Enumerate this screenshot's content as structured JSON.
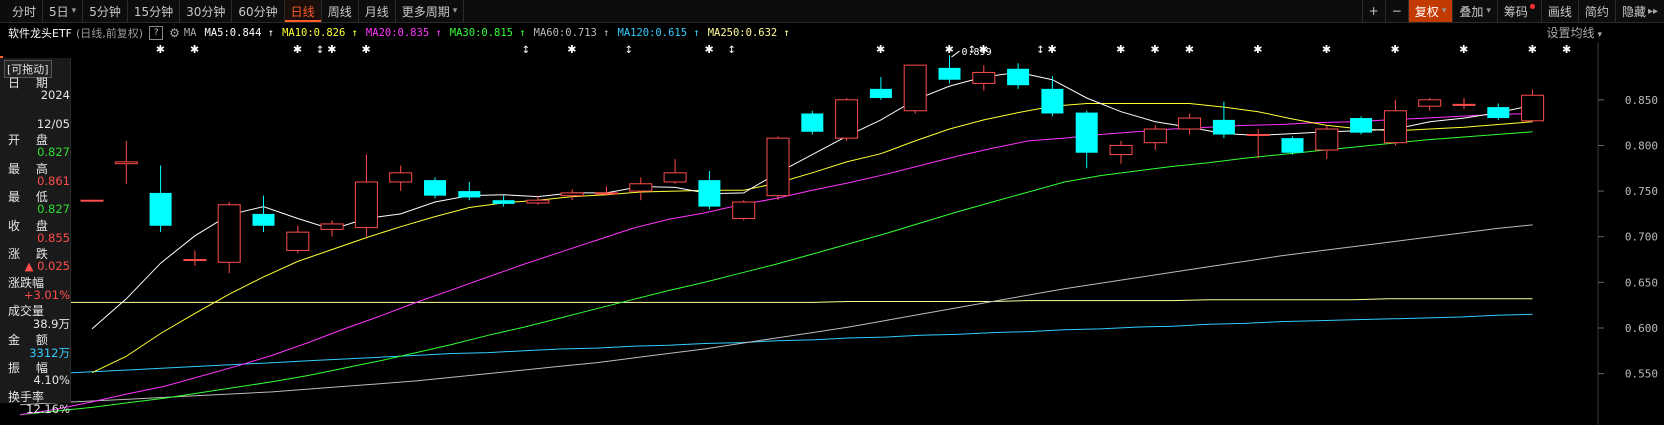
{
  "toolbar": {
    "periods": [
      {
        "label": "分时",
        "caret": false,
        "active": false
      },
      {
        "label": "5日",
        "caret": true,
        "active": false
      },
      {
        "label": "5分钟",
        "caret": false,
        "active": false
      },
      {
        "label": "15分钟",
        "caret": false,
        "active": false
      },
      {
        "label": "30分钟",
        "caret": false,
        "active": false
      },
      {
        "label": "60分钟",
        "caret": false,
        "active": false
      },
      {
        "label": "日线",
        "caret": false,
        "active": true
      },
      {
        "label": "周线",
        "caret": false,
        "active": false
      },
      {
        "label": "月线",
        "caret": false,
        "active": false
      },
      {
        "label": "更多周期",
        "caret": true,
        "active": false
      }
    ],
    "right": {
      "plus": "+",
      "minus": "−",
      "fq": "复权",
      "overlay": "叠加",
      "chips": "筹码",
      "draw": "画线",
      "simple": "简约",
      "hide": "隐藏",
      "hide_arrow": "▸▸"
    }
  },
  "header": {
    "name": "软件龙头ETF",
    "sub": "(日线,前复权)",
    "q": "?",
    "gear": "⚙",
    "ma_label": "MA",
    "set_ma": "设置均线",
    "set_ma_caret": "▾",
    "mas": [
      {
        "label": "MA5:0.844",
        "arrow": "↑",
        "color": "#ffffff"
      },
      {
        "label": "MA10:0.826",
        "arrow": "↑",
        "color": "#ffff33"
      },
      {
        "label": "MA20:0.835",
        "arrow": "↑",
        "color": "#ff33ff"
      },
      {
        "label": "MA30:0.815",
        "arrow": "↑",
        "color": "#33ff33"
      },
      {
        "label": "MA60:0.713",
        "arrow": "↑",
        "color": "#bbbbbb"
      },
      {
        "label": "MA120:0.615",
        "arrow": "↑",
        "color": "#33ccff"
      },
      {
        "label": "MA250:0.632",
        "arrow": "↑",
        "color": "#ffff99"
      }
    ]
  },
  "info": {
    "drag_label": "[可拖动]",
    "rows": [
      {
        "label": "日 期",
        "value": "2024",
        "color": "#e6e6e6"
      },
      {
        "label": "",
        "value": "12/05",
        "color": "#e6e6e6"
      },
      {
        "label": "开 盘",
        "value": "0.827",
        "color": "#33dd33"
      },
      {
        "label": "最 高",
        "value": "0.861",
        "color": "#ff4d4d"
      },
      {
        "label": "最 低",
        "value": "0.827",
        "color": "#33dd33"
      },
      {
        "label": "收 盘",
        "value": "0.855",
        "color": "#ff4d4d"
      },
      {
        "label": "涨 跌",
        "value": "▲ 0.025",
        "color": "#ff4d4d"
      },
      {
        "label": "涨跌幅",
        "value": "+3.01%",
        "color": "#ff4d4d"
      },
      {
        "label": "成交量",
        "value": "38.9万",
        "color": "#e6e6e6"
      },
      {
        "label": "金 额",
        "value": "3312万",
        "color": "#33ccff"
      },
      {
        "label": "振 幅",
        "value": "4.10%",
        "color": "#e6e6e6"
      },
      {
        "label": "换手率",
        "value": "12.16%",
        "color": "#e6e6e6"
      }
    ]
  },
  "chart_data": {
    "type": "candlestick",
    "y_ticks": [
      0.85,
      0.8,
      0.75,
      0.7,
      0.65,
      0.6,
      0.55
    ],
    "y_tick_labels": [
      "0.850",
      "0.800",
      "0.750",
      "0.700",
      "0.650",
      "0.600",
      "0.550"
    ],
    "ylim": [
      0.497,
      0.898
    ],
    "annotation": "0.899",
    "colors": {
      "up": "#ff4d4d",
      "down": "#00ffff",
      "ma5": "#ffffff",
      "ma10": "#ffff33",
      "ma20": "#ff33ff",
      "ma30": "#33ff33",
      "ma60": "#bbbbbb",
      "ma120": "#33ccff",
      "ma250": "#ffff99",
      "grid": "#333333"
    },
    "candles": [
      {
        "o": 0.74,
        "h": 0.74,
        "l": 0.74,
        "c": 0.74
      },
      {
        "o": 0.78,
        "h": 0.805,
        "l": 0.758,
        "c": 0.782
      },
      {
        "o": 0.748,
        "h": 0.778,
        "l": 0.705,
        "c": 0.712
      },
      {
        "o": 0.675,
        "h": 0.685,
        "l": 0.668,
        "c": 0.675
      },
      {
        "o": 0.672,
        "h": 0.738,
        "l": 0.66,
        "c": 0.735
      },
      {
        "o": 0.725,
        "h": 0.745,
        "l": 0.705,
        "c": 0.712
      },
      {
        "o": 0.685,
        "h": 0.712,
        "l": 0.682,
        "c": 0.705
      },
      {
        "o": 0.708,
        "h": 0.718,
        "l": 0.7,
        "c": 0.714
      },
      {
        "o": 0.71,
        "h": 0.79,
        "l": 0.7,
        "c": 0.76
      },
      {
        "o": 0.76,
        "h": 0.778,
        "l": 0.75,
        "c": 0.77
      },
      {
        "o": 0.762,
        "h": 0.765,
        "l": 0.742,
        "c": 0.745
      },
      {
        "o": 0.75,
        "h": 0.76,
        "l": 0.74,
        "c": 0.743
      },
      {
        "o": 0.74,
        "h": 0.745,
        "l": 0.733,
        "c": 0.736
      },
      {
        "o": 0.737,
        "h": 0.745,
        "l": 0.735,
        "c": 0.74
      },
      {
        "o": 0.745,
        "h": 0.752,
        "l": 0.74,
        "c": 0.748
      },
      {
        "o": 0.748,
        "h": 0.755,
        "l": 0.745,
        "c": 0.748
      },
      {
        "o": 0.75,
        "h": 0.765,
        "l": 0.74,
        "c": 0.758
      },
      {
        "o": 0.76,
        "h": 0.785,
        "l": 0.758,
        "c": 0.77
      },
      {
        "o": 0.762,
        "h": 0.772,
        "l": 0.73,
        "c": 0.733
      },
      {
        "o": 0.72,
        "h": 0.74,
        "l": 0.718,
        "c": 0.738
      },
      {
        "o": 0.745,
        "h": 0.81,
        "l": 0.74,
        "c": 0.808
      },
      {
        "o": 0.835,
        "h": 0.838,
        "l": 0.812,
        "c": 0.815
      },
      {
        "o": 0.808,
        "h": 0.852,
        "l": 0.805,
        "c": 0.85
      },
      {
        "o": 0.862,
        "h": 0.875,
        "l": 0.85,
        "c": 0.852
      },
      {
        "o": 0.838,
        "h": 0.888,
        "l": 0.835,
        "c": 0.888
      },
      {
        "o": 0.885,
        "h": 0.899,
        "l": 0.868,
        "c": 0.872
      },
      {
        "o": 0.868,
        "h": 0.888,
        "l": 0.86,
        "c": 0.88
      },
      {
        "o": 0.884,
        "h": 0.89,
        "l": 0.862,
        "c": 0.866
      },
      {
        "o": 0.862,
        "h": 0.876,
        "l": 0.832,
        "c": 0.835
      },
      {
        "o": 0.836,
        "h": 0.838,
        "l": 0.775,
        "c": 0.792
      },
      {
        "o": 0.79,
        "h": 0.805,
        "l": 0.78,
        "c": 0.8
      },
      {
        "o": 0.803,
        "h": 0.822,
        "l": 0.795,
        "c": 0.818
      },
      {
        "o": 0.818,
        "h": 0.835,
        "l": 0.812,
        "c": 0.83
      },
      {
        "o": 0.828,
        "h": 0.848,
        "l": 0.808,
        "c": 0.812
      },
      {
        "o": 0.812,
        "h": 0.818,
        "l": 0.786,
        "c": 0.812
      },
      {
        "o": 0.808,
        "h": 0.81,
        "l": 0.79,
        "c": 0.792
      },
      {
        "o": 0.795,
        "h": 0.822,
        "l": 0.785,
        "c": 0.818
      },
      {
        "o": 0.83,
        "h": 0.832,
        "l": 0.812,
        "c": 0.814
      },
      {
        "o": 0.803,
        "h": 0.85,
        "l": 0.8,
        "c": 0.838
      },
      {
        "o": 0.843,
        "h": 0.852,
        "l": 0.838,
        "c": 0.85
      },
      {
        "o": 0.845,
        "h": 0.852,
        "l": 0.84,
        "c": 0.845
      },
      {
        "o": 0.842,
        "h": 0.846,
        "l": 0.828,
        "c": 0.83
      },
      {
        "o": 0.827,
        "h": 0.861,
        "l": 0.827,
        "c": 0.855
      }
    ],
    "ma_lines": {
      "ma5": [
        0.599,
        0.632,
        0.671,
        0.701,
        0.724,
        0.733,
        0.72,
        0.708,
        0.72,
        0.725,
        0.738,
        0.745,
        0.746,
        0.744,
        0.748,
        0.748,
        0.755,
        0.754,
        0.747,
        0.748,
        0.77,
        0.79,
        0.81,
        0.828,
        0.85,
        0.865,
        0.875,
        0.88,
        0.872,
        0.852,
        0.837,
        0.826,
        0.82,
        0.813,
        0.811,
        0.813,
        0.815,
        0.816,
        0.818,
        0.826,
        0.83,
        0.836,
        0.844
      ],
      "ma10": [
        0.551,
        0.569,
        0.594,
        0.616,
        0.637,
        0.656,
        0.673,
        0.686,
        0.699,
        0.711,
        0.722,
        0.732,
        0.737,
        0.74,
        0.744,
        0.746,
        0.749,
        0.75,
        0.751,
        0.751,
        0.759,
        0.77,
        0.782,
        0.791,
        0.805,
        0.818,
        0.828,
        0.836,
        0.843,
        0.846,
        0.846,
        0.846,
        0.846,
        0.842,
        0.837,
        0.829,
        0.822,
        0.818,
        0.816,
        0.818,
        0.82,
        0.823,
        0.826
      ],
      "ma20": [
        0.505,
        0.511,
        0.519,
        0.528,
        0.536,
        0.547,
        0.558,
        0.57,
        0.584,
        0.599,
        0.613,
        0.628,
        0.642,
        0.656,
        0.67,
        0.683,
        0.696,
        0.709,
        0.719,
        0.726,
        0.735,
        0.742,
        0.751,
        0.759,
        0.768,
        0.778,
        0.788,
        0.797,
        0.805,
        0.808,
        0.812,
        0.815,
        0.818,
        0.82,
        0.822,
        0.823,
        0.825,
        0.826,
        0.828,
        0.83,
        0.832,
        0.834,
        0.835
      ],
      "ma30": [
        0.505,
        0.509,
        0.513,
        0.518,
        0.523,
        0.529,
        0.535,
        0.541,
        0.548,
        0.556,
        0.564,
        0.573,
        0.582,
        0.592,
        0.601,
        0.611,
        0.621,
        0.631,
        0.641,
        0.65,
        0.66,
        0.67,
        0.681,
        0.692,
        0.703,
        0.715,
        0.727,
        0.738,
        0.749,
        0.76,
        0.767,
        0.772,
        0.777,
        0.781,
        0.786,
        0.79,
        0.794,
        0.798,
        0.802,
        0.806,
        0.809,
        0.812,
        0.815
      ],
      "ma60": [
        0.516,
        0.518,
        0.52,
        0.522,
        0.524,
        0.526,
        0.528,
        0.53,
        0.533,
        0.536,
        0.539,
        0.542,
        0.546,
        0.55,
        0.554,
        0.558,
        0.562,
        0.567,
        0.572,
        0.577,
        0.583,
        0.589,
        0.595,
        0.601,
        0.608,
        0.615,
        0.622,
        0.629,
        0.636,
        0.643,
        0.649,
        0.655,
        0.661,
        0.667,
        0.673,
        0.679,
        0.684,
        0.689,
        0.694,
        0.699,
        0.704,
        0.709,
        0.713
      ],
      "ma120": [
        0.548,
        0.55,
        0.552,
        0.554,
        0.556,
        0.558,
        0.56,
        0.562,
        0.564,
        0.566,
        0.568,
        0.57,
        0.572,
        0.573,
        0.575,
        0.577,
        0.578,
        0.58,
        0.581,
        0.583,
        0.584,
        0.586,
        0.587,
        0.589,
        0.59,
        0.592,
        0.593,
        0.595,
        0.596,
        0.598,
        0.599,
        0.601,
        0.602,
        0.604,
        0.605,
        0.607,
        0.608,
        0.609,
        0.61,
        0.611,
        0.612,
        0.614,
        0.615
      ],
      "ma250": [
        0.628,
        0.628,
        0.628,
        0.628,
        0.628,
        0.628,
        0.628,
        0.628,
        0.628,
        0.628,
        0.628,
        0.628,
        0.628,
        0.628,
        0.628,
        0.628,
        0.628,
        0.628,
        0.628,
        0.628,
        0.628,
        0.628,
        0.628,
        0.629,
        0.629,
        0.629,
        0.629,
        0.629,
        0.63,
        0.63,
        0.63,
        0.63,
        0.63,
        0.631,
        0.631,
        0.631,
        0.631,
        0.631,
        0.632,
        0.632,
        0.632,
        0.632,
        0.632
      ]
    },
    "marker_indices": [
      1,
      2,
      5,
      6,
      7,
      13,
      17,
      22,
      24,
      25,
      27,
      29,
      30,
      31,
      33,
      35,
      37,
      39,
      41,
      42
    ],
    "arrow_indices": [
      7,
      13,
      16,
      19,
      26,
      28
    ]
  }
}
